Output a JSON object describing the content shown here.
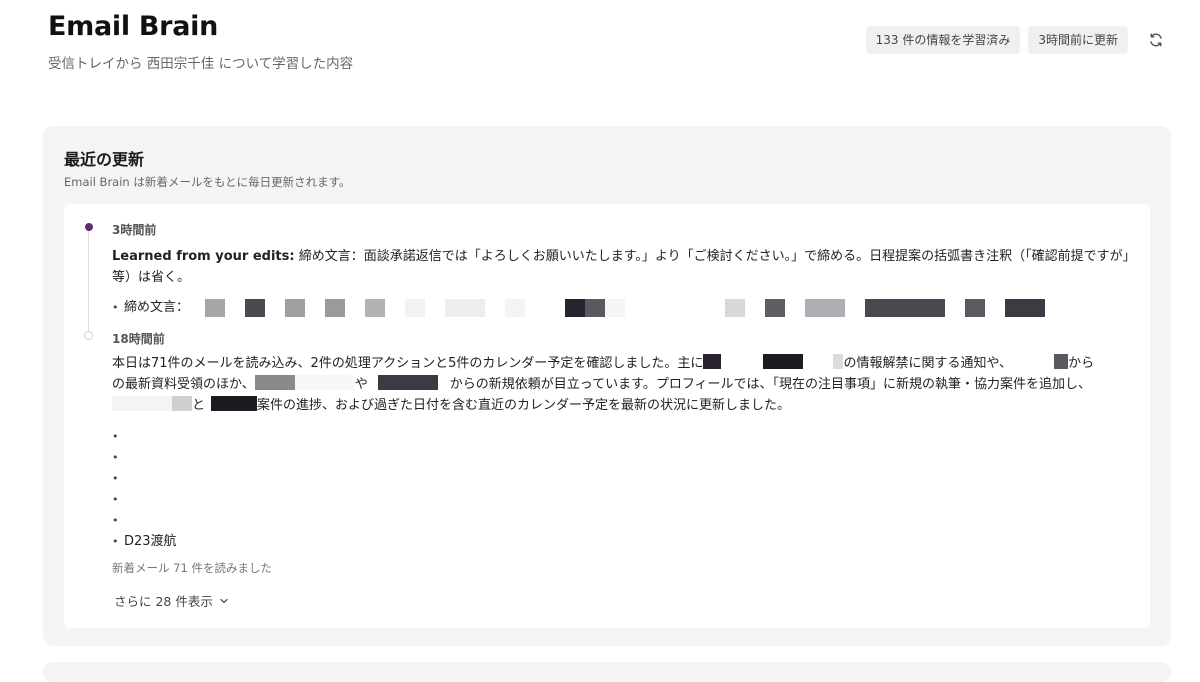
{
  "header": {
    "title": "Email Brain",
    "subtitle": "受信トレイから 西田宗千佳 について学習した内容",
    "learned_count": "133 件の情報を学習済み",
    "updated": "3時間前に更新",
    "refresh_icon": "refresh-icon"
  },
  "panel": {
    "title": "最近の更新",
    "description": "Email Brain は新着メールをもとに毎日更新されます。"
  },
  "entries": [
    {
      "time": "3時間前",
      "prefix": "Learned from your edits:",
      "text": " 締め文言：面談承諾返信では「よろしくお願いいたします。」より「ご検討ください。」で締める。日程提案の括弧書き注釈（「確認前提ですが」等）は省く。",
      "bullet_label": "締め文言："
    },
    {
      "time": "18時間前",
      "t1": "本日は71件のメールを読み込み、2件の処理アクションと5件のカレンダー予定を確認しました。主に",
      "t2": "の情報解禁に関する通知や、",
      "t3": "から",
      "t4": "の最新資料受領のほか、",
      "t5": "や",
      "t6": "からの新規依頼が目立っています。プロフィールでは、「現在の注目事項」に新規の執筆・協力案件を追加し、",
      "t7": "と",
      "t8": "案件の進捗、および過ぎた日付を含む直近のカレンダー予定を最新の状況に更新しました。",
      "last_bullet": "D23渡航",
      "footer": "新着メール 71 件を読みました"
    }
  ],
  "show_more": "さらに 28 件表示",
  "colors": {
    "accent": "#5e2f6e",
    "panel_bg": "#f4f4f5",
    "chip_bg": "#f0f0f0"
  }
}
